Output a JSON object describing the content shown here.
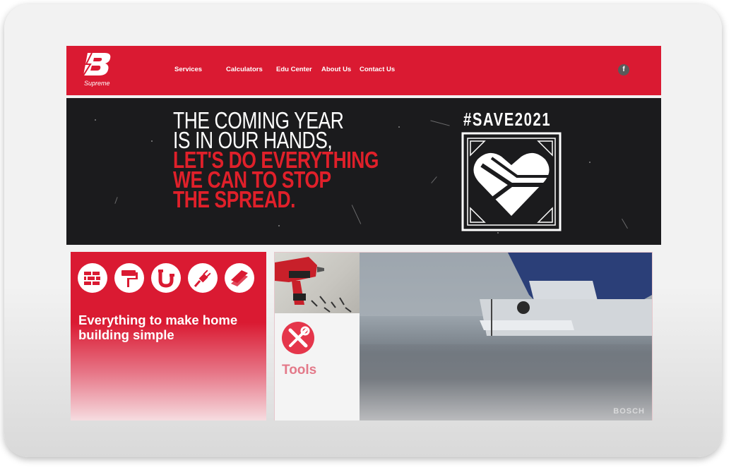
{
  "brand": {
    "logo_letter": "B",
    "name": "Supreme"
  },
  "nav": [
    {
      "label": "Services"
    },
    {
      "label": "Calculators"
    },
    {
      "label": "Edu Center"
    },
    {
      "label": "About Us"
    },
    {
      "label": "Contact Us"
    }
  ],
  "social": {
    "facebook_label": "f"
  },
  "banner": {
    "lines_white": [
      "THE COMING YEAR",
      "IS IN OUR HANDS,"
    ],
    "lines_red": [
      "LET'S DO EVERYTHING",
      "WE CAN TO STOP",
      "THE SPREAD."
    ],
    "hashtag": "#SAVE2021"
  },
  "card_home": {
    "icons": [
      "brick-wall-icon",
      "paint-roller-icon",
      "plumbing-pipe-icon",
      "electric-plug-icon",
      "timber-planks-icon"
    ],
    "text": "Everything to make home building simple"
  },
  "card_tools": {
    "label": "Tools",
    "icon": "wrench-screwdriver-icon",
    "watermark": "BOSCH"
  },
  "colors": {
    "brand_red": "#da1a32",
    "banner_bg": "#1b1b1d",
    "banner_red": "#e0202a"
  }
}
